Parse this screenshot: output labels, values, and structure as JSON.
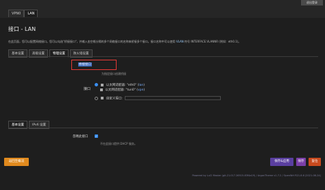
{
  "topbar": {
    "tabs": [
      {
        "label": "VPN0"
      },
      {
        "label": "LAN"
      }
    ],
    "logout_label": "退出登录"
  },
  "page": {
    "title": "接口 - LAN",
    "description_pre": "在此页面，您可以配置网络接口。您可以勾选\"桥接接口\"，并输入由空格分隔的多个网络接口的名称来桥接多个接口。接口名称中可以使用",
    "description_code": "VLAN",
    "description_post": "符号 INTERFACE.VLANNR (例如：eth0.1)。"
  },
  "tabs": [
    {
      "label": "基本设置"
    },
    {
      "label": "高级设置"
    },
    {
      "label": "物理设置"
    },
    {
      "label": "防火墙设置"
    }
  ],
  "physical": {
    "bridge_label": "桥接接口",
    "bridge_hint": "为指定接口创建桥接",
    "interface_label": "接口",
    "options": [
      {
        "label": "以太网适配器: \"eth0\" (",
        "tag": "lan",
        "suffix": ")"
      },
      {
        "label": "以太网适配器: \"tun0\" (",
        "tag": "vpn",
        "suffix": ")"
      }
    ],
    "custom_label": "自定义接口:"
  },
  "dhcp": {
    "tabs": [
      {
        "label": "基本设置"
      },
      {
        "label": "IPv6 设置"
      }
    ],
    "startup_label": "忽略此接口",
    "startup_hint": "不在此接口提供 DHCP 服务。"
  },
  "buttons": {
    "back": "返回至概况",
    "save_apply": "保存&应用",
    "save": "保存",
    "reset": "复位"
  },
  "footer": "Powered by LuCI Master (git-21.017.26515-83f4a19) / ArgonTheme v1.7.2 / OpenWrt R21.8.6 (2021-08-24)"
}
